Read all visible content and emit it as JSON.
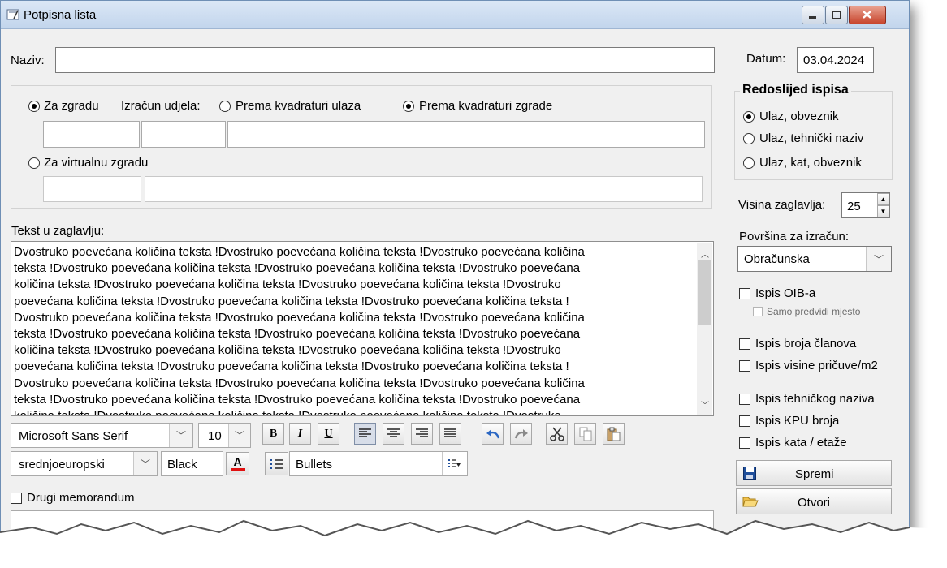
{
  "window": {
    "title": "Potpisna lista"
  },
  "form": {
    "naziv_label": "Naziv:",
    "naziv_value": "",
    "datum_label": "Datum:",
    "datum_value": "03.04.2024"
  },
  "building": {
    "za_zgradu": "Za zgradu",
    "izracun_label": "Izračun udjela:",
    "prema_ulaza": "Prema kvadraturi ulaza",
    "prema_zgrade": "Prema kvadraturi zgrade",
    "za_virtualnu": "Za virtualnu zgradu"
  },
  "order": {
    "title": "Redoslijed ispisa",
    "options": [
      "Ulaz, obveznik",
      "Ulaz, tehnički naziv",
      "Ulaz, kat, obveznik"
    ]
  },
  "header_height": {
    "label": "Visina zaglavlja:",
    "value": "25"
  },
  "surface": {
    "label": "Površina za izračun:",
    "value": "Obračunska"
  },
  "checks": {
    "oib": "Ispis OIB-a",
    "samo_predvidi": "Samo predvidi mjesto",
    "broj_clanova": "Ispis broja članova",
    "visina_pricuve": "Ispis visine pričuve/m2",
    "tehnicki_naziv": "Ispis tehničkog naziva",
    "kpu": "Ispis KPU broja",
    "kat": "Ispis kata / etaže"
  },
  "buttons": {
    "spremi": "Spremi",
    "otvori": "Otvori"
  },
  "editor": {
    "label": "Tekst u zaglavlju:",
    "lines": [
      "Dvostruko poevećana količina teksta !Dvostruko poevećana količina teksta !Dvostruko poevećana količina",
      "teksta !Dvostruko poevećana količina teksta !Dvostruko poevećana količina teksta !Dvostruko poevećana",
      "količina teksta !Dvostruko poevećana količina teksta !Dvostruko poevećana količina teksta !Dvostruko",
      "poevećana količina teksta !Dvostruko poevećana količina teksta !Dvostruko poevećana količina teksta !",
      "Dvostruko poevećana količina teksta !Dvostruko poevećana količina teksta !Dvostruko poevećana količina",
      "teksta !Dvostruko poevećana količina teksta !Dvostruko poevećana količina teksta !Dvostruko poevećana",
      "količina teksta !Dvostruko poevećana količina teksta !Dvostruko poevećana količina teksta !Dvostruko",
      "poevećana količina teksta !Dvostruko poevećana količina teksta !Dvostruko poevećana količina teksta !",
      "Dvostruko poevećana količina teksta !Dvostruko poevećana količina teksta !Dvostruko poevećana količina",
      "teksta !Dvostruko poevećana količina teksta !Dvostruko poevećana količina teksta !Dvostruko poevećana",
      "količina teksta !Dvostruko poevećana količina teksta !Dvostruko poevećana količina teksta !Dvostruko"
    ]
  },
  "format": {
    "font_name": "Microsoft Sans Serif",
    "font_size": "10",
    "charset": "srednjoeuropski",
    "color_name": "Black",
    "bullets": "Bullets",
    "bold": "B",
    "italic": "I",
    "underline": "U"
  },
  "memo": {
    "label": "Drugi memorandum"
  },
  "colors": {
    "accent": "#1e4e9b",
    "window_bg": "#f0f0f0"
  }
}
